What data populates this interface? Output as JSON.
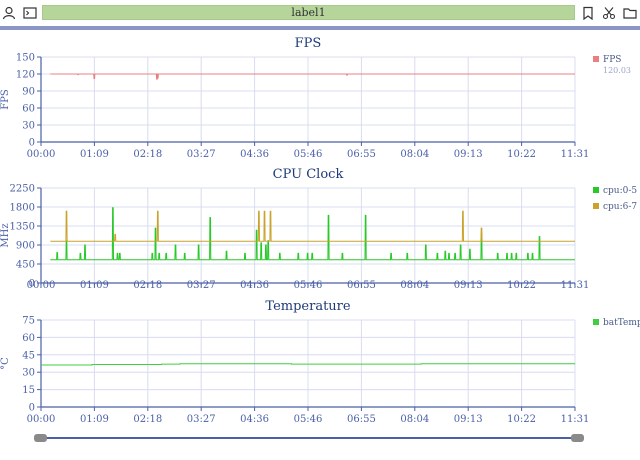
{
  "toolbar": {
    "label": "label1",
    "icons_left": [
      "user-icon",
      "terminal-icon"
    ],
    "icons_right": [
      "bookmark-icon",
      "scissors-icon",
      "folder-icon"
    ]
  },
  "colors": {
    "fps": "#e88080",
    "cpu05": "#28c828",
    "cpu67": "#c9a32b",
    "temp": "#42cc42",
    "axis": "#4a5fa8",
    "title": "#1d3a7a",
    "grid": "#d8dcf0"
  },
  "x_ticks": [
    "00:00",
    "01:09",
    "02:18",
    "03:27",
    "04:36",
    "05:46",
    "06:55",
    "08:04",
    "09:13",
    "10:22",
    "11:31"
  ],
  "chart_data": [
    {
      "type": "line",
      "title": "FPS",
      "ylabel": "FPS",
      "ylim": [
        0,
        150
      ],
      "yticks": [
        "0",
        "30",
        "60",
        "90",
        "120",
        "150"
      ],
      "legend": [
        {
          "name": "FPS",
          "value": "120.03",
          "color_key": "fps"
        }
      ],
      "series": [
        {
          "name": "FPS",
          "baseline": 120,
          "dips": [
            [
              0.8,
              119
            ],
            [
              1.15,
              112
            ],
            [
              2.5,
              111
            ],
            [
              2.52,
              113
            ],
            [
              6.6,
              118
            ]
          ]
        }
      ]
    },
    {
      "type": "line",
      "title": "CPU Clock",
      "ylabel": "MHz",
      "ylim": [
        0,
        2250
      ],
      "yticks": [
        "0",
        "450",
        "900",
        "1350",
        "1800",
        "2250"
      ],
      "legend": [
        {
          "name": "cpu:0-5",
          "color_key": "cpu05"
        },
        {
          "name": "cpu:6-7",
          "color_key": "cpu67"
        }
      ],
      "series": [
        {
          "name": "cpu:0-5",
          "baseline": 550,
          "spikes": [
            [
              0.35,
              720
            ],
            [
              0.55,
              1000
            ],
            [
              0.85,
              700
            ],
            [
              0.95,
              900
            ],
            [
              1.55,
              1780
            ],
            [
              1.65,
              700
            ],
            [
              1.7,
              700
            ],
            [
              2.4,
              700
            ],
            [
              2.47,
              1300
            ],
            [
              2.55,
              700
            ],
            [
              2.7,
              700
            ],
            [
              2.9,
              900
            ],
            [
              3.1,
              700
            ],
            [
              3.4,
              900
            ],
            [
              3.65,
              1550
            ],
            [
              4.0,
              750
            ],
            [
              4.4,
              700
            ],
            [
              4.65,
              1250
            ],
            [
              4.75,
              950
            ],
            [
              4.85,
              900
            ],
            [
              4.9,
              1000
            ],
            [
              5.15,
              700
            ],
            [
              5.55,
              700
            ],
            [
              5.75,
              700
            ],
            [
              5.85,
              700
            ],
            [
              6.2,
              1600
            ],
            [
              6.5,
              700
            ],
            [
              7.0,
              1600
            ],
            [
              7.55,
              700
            ],
            [
              7.9,
              700
            ],
            [
              8.3,
              900
            ],
            [
              8.55,
              700
            ],
            [
              8.72,
              750
            ],
            [
              8.8,
              700
            ],
            [
              8.93,
              700
            ],
            [
              9.05,
              900
            ],
            [
              9.25,
              800
            ],
            [
              9.5,
              1150
            ],
            [
              9.85,
              700
            ],
            [
              10.05,
              700
            ],
            [
              10.15,
              700
            ],
            [
              10.25,
              700
            ],
            [
              10.5,
              700
            ],
            [
              10.6,
              700
            ],
            [
              10.75,
              1100
            ]
          ]
        },
        {
          "name": "cpu:6-7",
          "baseline": 990,
          "spikes": [
            [
              0.55,
              1700
            ],
            [
              1.6,
              1150
            ],
            [
              2.52,
              1700
            ],
            [
              4.7,
              1700
            ],
            [
              4.82,
              1700
            ],
            [
              4.95,
              1700
            ],
            [
              9.1,
              1700
            ],
            [
              9.5,
              1300
            ]
          ]
        }
      ]
    },
    {
      "type": "line",
      "title": "Temperature",
      "ylabel": "°C",
      "ylim": [
        0,
        75
      ],
      "yticks": [
        "0",
        "15",
        "30",
        "45",
        "60",
        "75"
      ],
      "legend": [
        {
          "name": "batTemp",
          "color_key": "temp"
        }
      ],
      "series": [
        {
          "name": "batTemp",
          "points": [
            [
              0,
              36.2
            ],
            [
              1.1,
              36.2
            ],
            [
              1.1,
              36.6
            ],
            [
              2.6,
              36.6
            ],
            [
              2.6,
              37
            ],
            [
              3.0,
              37
            ],
            [
              3.0,
              37.3
            ],
            [
              5.4,
              37.3
            ],
            [
              5.4,
              37.0
            ],
            [
              8.2,
              37.0
            ],
            [
              8.2,
              37.3
            ],
            [
              11.52,
              37.3
            ]
          ]
        }
      ]
    }
  ],
  "slider": {
    "start": 0,
    "end": 1
  }
}
